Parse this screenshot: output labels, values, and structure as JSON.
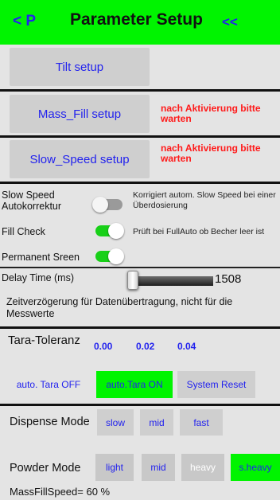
{
  "header": {
    "back_label": "< P",
    "title": "Parameter Setup",
    "forward_label": "<<"
  },
  "buttons": {
    "tilt_setup": "Tilt setup",
    "mass_fill_setup": "Mass_Fill  setup",
    "slow_speed_setup": "Slow_Speed setup"
  },
  "warnings": {
    "mass_fill": "nach Aktivierung bitte warten",
    "slow_speed": "nach Aktivierung bitte warten"
  },
  "settings": {
    "slow_speed_label": "Slow Speed Autokorrektur",
    "slow_speed_desc": "Korrigiert autom. Slow Speed bei einer Überdosierung",
    "fill_check_label": "Fill Check",
    "fill_check_desc": "Prüft bei FullAuto ob Becher leer ist",
    "permanent_screen_label": "Permanent Sreen",
    "slow_speed_on": false,
    "fill_check_on": true,
    "permanent_screen_on": true
  },
  "delay": {
    "label": "Delay Time (ms)",
    "value": "1508",
    "desc": "Zeitverzögerung für Datenübertragung, nicht für die Messwerte"
  },
  "tara": {
    "label": "Tara-Toleranz",
    "values": [
      "0.00",
      "0.02",
      "0.04"
    ],
    "off_label": "auto. Tara OFF",
    "on_label": "auto.Tara ON",
    "reset_label": "System Reset"
  },
  "dispense": {
    "label": "Dispense Mode",
    "options": [
      "slow",
      "mid",
      "fast"
    ]
  },
  "powder": {
    "label": "Powder Mode",
    "options": [
      "light",
      "mid",
      "heavy",
      "s.heavy"
    ],
    "selected": "s.heavy"
  },
  "mass_fill_speed": "MassFillSpeed= 60 %",
  "colors": {
    "accent_green": "#00f400",
    "link_blue": "#2222ee",
    "warning_red": "#ff1a1a"
  }
}
